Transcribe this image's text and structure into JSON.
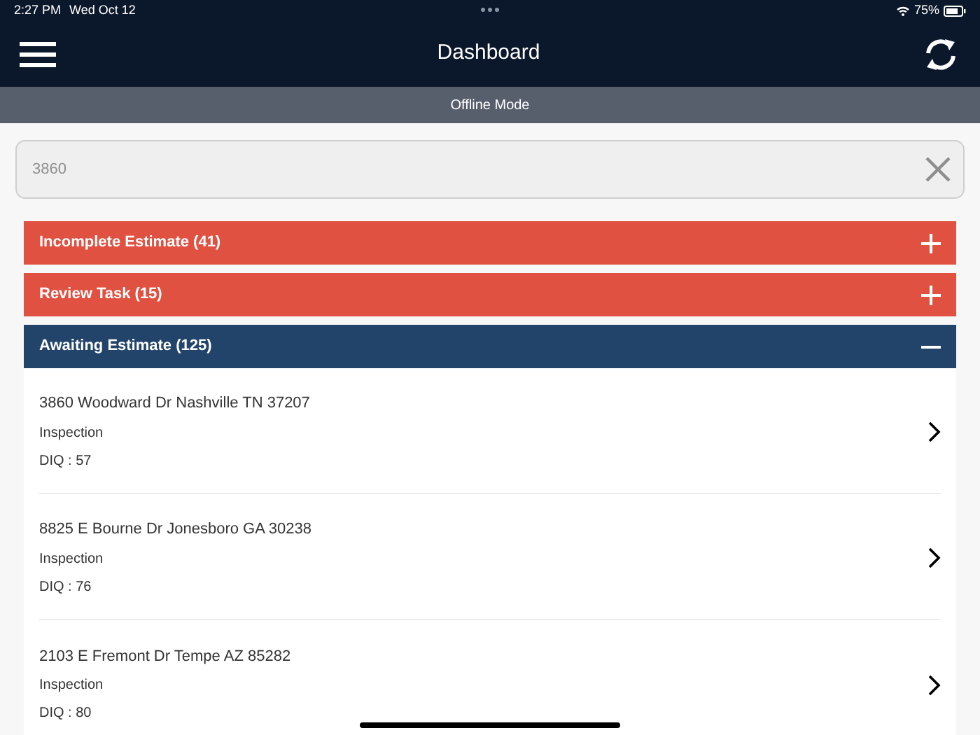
{
  "status_bar": {
    "time": "2:27 PM",
    "date": "Wed Oct 12",
    "battery": "75%"
  },
  "header": {
    "title": "Dashboard"
  },
  "banner": "Offline Mode",
  "search": {
    "value": "3860"
  },
  "sections": [
    {
      "title": "Incomplete Estimate (41)",
      "expanded": false
    },
    {
      "title": "Review Task (15)",
      "expanded": false
    },
    {
      "title": "Awaiting Estimate (125)",
      "expanded": true,
      "items": [
        {
          "address": "3860 Woodward Dr Nashville TN 37207",
          "type": "Inspection",
          "diq": "DIQ : 57"
        },
        {
          "address": "8825 E Bourne Dr Jonesboro GA 30238",
          "type": "Inspection",
          "diq": "DIQ : 76"
        },
        {
          "address": "2103 E Fremont Dr Tempe AZ 85282",
          "type": "Inspection",
          "diq": "DIQ : 80"
        }
      ]
    }
  ]
}
